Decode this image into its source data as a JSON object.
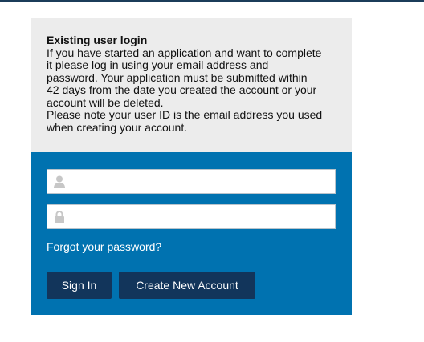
{
  "info": {
    "title": "Existing user login",
    "body": "If you have started an application and want to complete\nit please log in using your email address and\npassword. Your application must be submitted within\n42 days from the date you created the account or your\naccount will be deleted.\nPlease note your user ID is the email address you used\nwhen creating your account."
  },
  "form": {
    "username": {
      "value": "",
      "placeholder": "",
      "icon": "user-icon"
    },
    "password": {
      "value": "",
      "placeholder": "",
      "icon": "lock-icon"
    },
    "forgot_password_label": "Forgot your password?",
    "sign_in_label": "Sign In",
    "create_account_label": "Create New Account"
  },
  "colors": {
    "top_bar": "#1b3c59",
    "info_background": "#ececec",
    "form_background": "#0072b0",
    "button_background": "#12355b",
    "icon_gray": "#c7c7c7"
  }
}
